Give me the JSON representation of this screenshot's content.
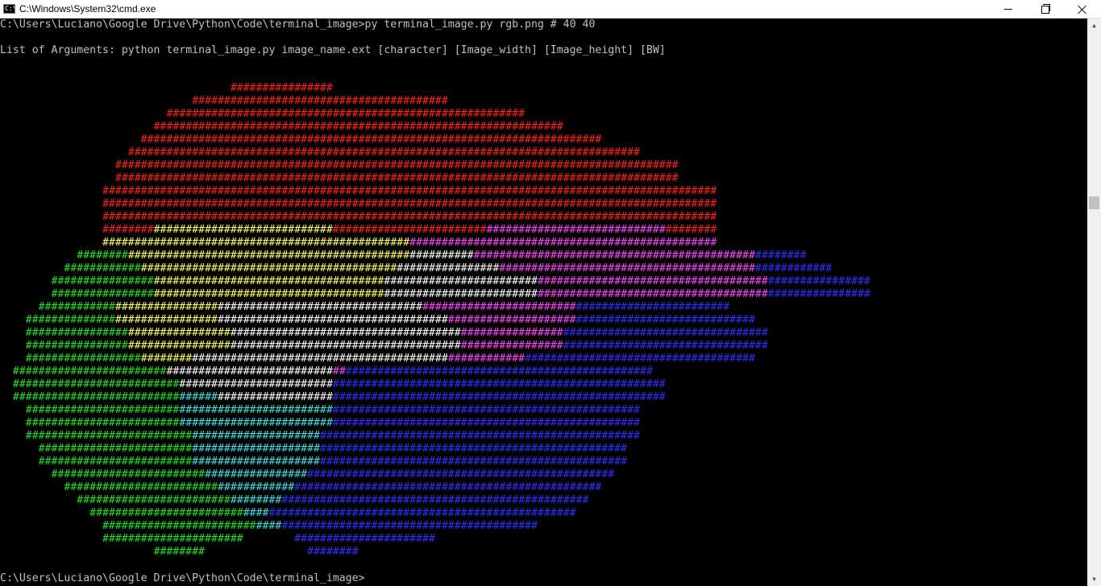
{
  "window": {
    "title": "C:\\Windows\\System32\\cmd.exe",
    "icon": "cmd-icon",
    "icon_text": "C:\\"
  },
  "console": {
    "command_line": "C:\\Users\\Luciano\\Google Drive\\Python\\Code\\terminal_image>py terminal_image.py rgb.png # 40 40",
    "args_line": "List of Arguments: python terminal_image.py image_name.ext [character] [Image_width] [Image_height] [BW]",
    "prompt_line": "C:\\Users\\Luciano\\Google Drive\\Python\\Code\\terminal_image>"
  },
  "art": {
    "palette": {
      "R": "#ff2020",
      "Y": "#ffff60",
      "M": "#ff40ff",
      "W": "#ffffff",
      "G": "#20e020",
      "C": "#40e0e0",
      "B": "#3030ff"
    },
    "rows": [
      [
        [
          18,
          "",
          " "
        ],
        [
          8,
          "R",
          "#"
        ]
      ],
      [
        [
          15,
          "",
          " "
        ],
        [
          20,
          "R",
          "#"
        ]
      ],
      [
        [
          13,
          "",
          " "
        ],
        [
          28,
          "R",
          "#"
        ]
      ],
      [
        [
          12,
          "",
          " "
        ],
        [
          32,
          "R",
          "#"
        ]
      ],
      [
        [
          11,
          "",
          " "
        ],
        [
          36,
          "R",
          "#"
        ]
      ],
      [
        [
          10,
          "",
          " "
        ],
        [
          40,
          "R",
          "#"
        ]
      ],
      [
        [
          9,
          "",
          " "
        ],
        [
          44,
          "R",
          "#"
        ]
      ],
      [
        [
          9,
          "",
          " "
        ],
        [
          44,
          "R",
          "#"
        ]
      ],
      [
        [
          8,
          "",
          " "
        ],
        [
          48,
          "R",
          "#"
        ]
      ],
      [
        [
          8,
          "",
          " "
        ],
        [
          48,
          "R",
          "#"
        ]
      ],
      [
        [
          8,
          "",
          " "
        ],
        [
          48,
          "R",
          "#"
        ]
      ],
      [
        [
          8,
          "",
          " "
        ],
        [
          4,
          "R",
          "#"
        ],
        [
          14,
          "Y",
          "#"
        ],
        [
          12,
          "R",
          "#"
        ],
        [
          14,
          "M",
          "#"
        ],
        [
          4,
          "R",
          "#"
        ]
      ],
      [
        [
          8,
          "",
          " "
        ],
        [
          24,
          "Y",
          "#"
        ],
        [
          24,
          "M",
          "#"
        ]
      ],
      [
        [
          6,
          "",
          " "
        ],
        [
          4,
          "G",
          "#"
        ],
        [
          22,
          "Y",
          "#"
        ],
        [
          5,
          "W",
          "#"
        ],
        [
          22,
          "M",
          "#"
        ],
        [
          4,
          "B",
          "#"
        ]
      ],
      [
        [
          5,
          "",
          " "
        ],
        [
          6,
          "G",
          "#"
        ],
        [
          20,
          "Y",
          "#"
        ],
        [
          8,
          "W",
          "#"
        ],
        [
          20,
          "M",
          "#"
        ],
        [
          6,
          "B",
          "#"
        ]
      ],
      [
        [
          4,
          "",
          " "
        ],
        [
          8,
          "G",
          "#"
        ],
        [
          18,
          "Y",
          "#"
        ],
        [
          12,
          "W",
          "#"
        ],
        [
          18,
          "M",
          "#"
        ],
        [
          8,
          "B",
          "#"
        ]
      ],
      [
        [
          4,
          "",
          " "
        ],
        [
          8,
          "G",
          "#"
        ],
        [
          18,
          "Y",
          "#"
        ],
        [
          12,
          "W",
          "#"
        ],
        [
          18,
          "M",
          "#"
        ],
        [
          8,
          "B",
          "#"
        ]
      ],
      [
        [
          3,
          "",
          " "
        ],
        [
          6,
          "G",
          "#"
        ],
        [
          8,
          "Y",
          "#"
        ],
        [
          16,
          "W",
          "#"
        ],
        [
          12,
          "M",
          "#"
        ],
        [
          12,
          "B",
          "#"
        ]
      ],
      [
        [
          2,
          "",
          " "
        ],
        [
          7,
          "G",
          "#"
        ],
        [
          8,
          "Y",
          "#"
        ],
        [
          18,
          "W",
          "#"
        ],
        [
          10,
          "M",
          "#"
        ],
        [
          14,
          "B",
          "#"
        ]
      ],
      [
        [
          2,
          "",
          " "
        ],
        [
          8,
          "G",
          "#"
        ],
        [
          8,
          "Y",
          "#"
        ],
        [
          18,
          "W",
          "#"
        ],
        [
          8,
          "M",
          "#"
        ],
        [
          16,
          "B",
          "#"
        ]
      ],
      [
        [
          2,
          "",
          " "
        ],
        [
          8,
          "G",
          "#"
        ],
        [
          8,
          "Y",
          "#"
        ],
        [
          18,
          "W",
          "#"
        ],
        [
          8,
          "M",
          "#"
        ],
        [
          16,
          "B",
          "#"
        ]
      ],
      [
        [
          2,
          "",
          " "
        ],
        [
          9,
          "G",
          "#"
        ],
        [
          4,
          "Y",
          "#"
        ],
        [
          20,
          "W",
          "#"
        ],
        [
          6,
          "M",
          "#"
        ],
        [
          18,
          "B",
          "#"
        ]
      ],
      [
        [
          1,
          "",
          " "
        ],
        [
          12,
          "G",
          "#"
        ],
        [
          13,
          "W",
          "#"
        ],
        [
          1,
          "M",
          "#"
        ],
        [
          24,
          "B",
          "#"
        ]
      ],
      [
        [
          1,
          "",
          " "
        ],
        [
          13,
          "G",
          "#"
        ],
        [
          12,
          "W",
          "#"
        ],
        [
          26,
          "B",
          "#"
        ]
      ],
      [
        [
          1,
          "",
          " "
        ],
        [
          13,
          "G",
          "#"
        ],
        [
          3,
          "C",
          "#"
        ],
        [
          9,
          "W",
          "#"
        ],
        [
          26,
          "B",
          "#"
        ]
      ],
      [
        [
          2,
          "",
          " "
        ],
        [
          12,
          "G",
          "#"
        ],
        [
          12,
          "C",
          "#"
        ],
        [
          24,
          "B",
          "#"
        ]
      ],
      [
        [
          2,
          "",
          " "
        ],
        [
          12,
          "G",
          "#"
        ],
        [
          12,
          "C",
          "#"
        ],
        [
          24,
          "B",
          "#"
        ]
      ],
      [
        [
          2,
          "",
          " "
        ],
        [
          13,
          "G",
          "#"
        ],
        [
          10,
          "C",
          "#"
        ],
        [
          25,
          "B",
          "#"
        ]
      ],
      [
        [
          3,
          "",
          " "
        ],
        [
          12,
          "G",
          "#"
        ],
        [
          10,
          "C",
          "#"
        ],
        [
          24,
          "B",
          "#"
        ]
      ],
      [
        [
          3,
          "",
          " "
        ],
        [
          12,
          "G",
          "#"
        ],
        [
          10,
          "C",
          "#"
        ],
        [
          24,
          "B",
          "#"
        ]
      ],
      [
        [
          4,
          "",
          " "
        ],
        [
          12,
          "G",
          "#"
        ],
        [
          8,
          "C",
          "#"
        ],
        [
          24,
          "B",
          "#"
        ]
      ],
      [
        [
          5,
          "",
          " "
        ],
        [
          12,
          "G",
          "#"
        ],
        [
          6,
          "C",
          "#"
        ],
        [
          24,
          "B",
          "#"
        ]
      ],
      [
        [
          6,
          "",
          " "
        ],
        [
          12,
          "G",
          "#"
        ],
        [
          4,
          "C",
          "#"
        ],
        [
          24,
          "B",
          "#"
        ]
      ],
      [
        [
          7,
          "",
          " "
        ],
        [
          12,
          "G",
          "#"
        ],
        [
          2,
          "C",
          "#"
        ],
        [
          24,
          "B",
          "#"
        ]
      ],
      [
        [
          8,
          "",
          " "
        ],
        [
          12,
          "G",
          "#"
        ],
        [
          2,
          "C",
          "#"
        ],
        [
          20,
          "B",
          "#"
        ]
      ],
      [
        [
          8,
          "",
          " "
        ],
        [
          11,
          "G",
          "#"
        ],
        [
          4,
          "",
          " "
        ],
        [
          11,
          "B",
          "#"
        ]
      ],
      [
        [
          12,
          "",
          " "
        ],
        [
          4,
          "G",
          "#"
        ],
        [
          8,
          "",
          " "
        ],
        [
          4,
          "B",
          "#"
        ]
      ]
    ]
  }
}
